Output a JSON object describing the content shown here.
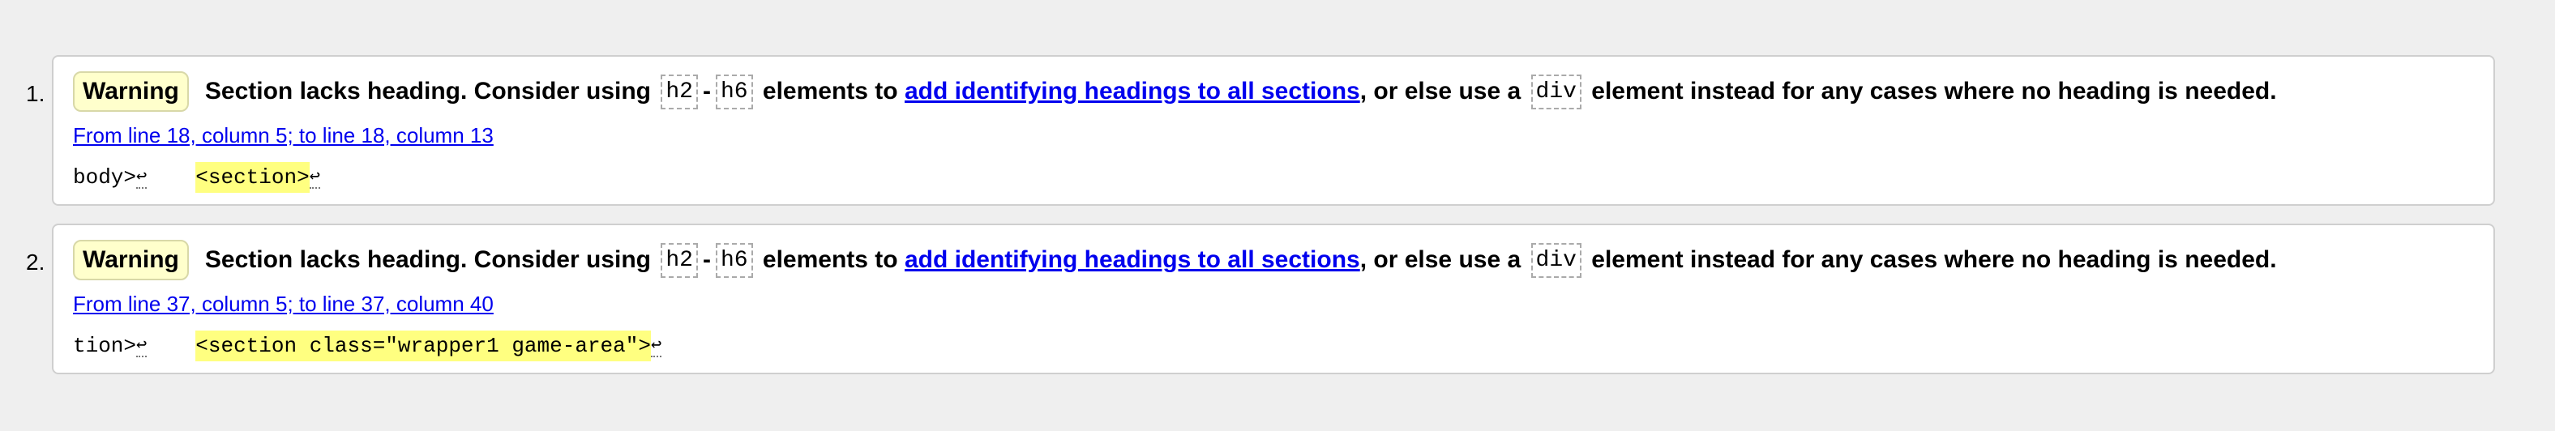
{
  "messages": [
    {
      "number": "1.",
      "type": "Warning",
      "text_before": "Section lacks heading. Consider using",
      "code1": "h2",
      "dash": "-",
      "code2": "h6",
      "text_mid": "elements to",
      "link": "add identifying headings to all sections",
      "text_after": ", or else use a",
      "code3": "div",
      "text_end": "element instead for any cases where no heading is needed.",
      "location": "From line 18, column 5; to line 18, column 13",
      "extract_before": "body>",
      "extract_highlight": "<section>",
      "return_glyph": "↩"
    },
    {
      "number": "2.",
      "type": "Warning",
      "text_before": "Section lacks heading. Consider using",
      "code1": "h2",
      "dash": "-",
      "code2": "h6",
      "text_mid": "elements to",
      "link": "add identifying headings to all sections",
      "text_after": ", or else use a",
      "code3": "div",
      "text_end": "element instead for any cases where no heading is needed.",
      "location": "From line 37, column 5; to line 37, column 40",
      "extract_before": "tion>",
      "extract_highlight": "<section class=\"wrapper1 game-area\">",
      "return_glyph": "↩"
    }
  ]
}
